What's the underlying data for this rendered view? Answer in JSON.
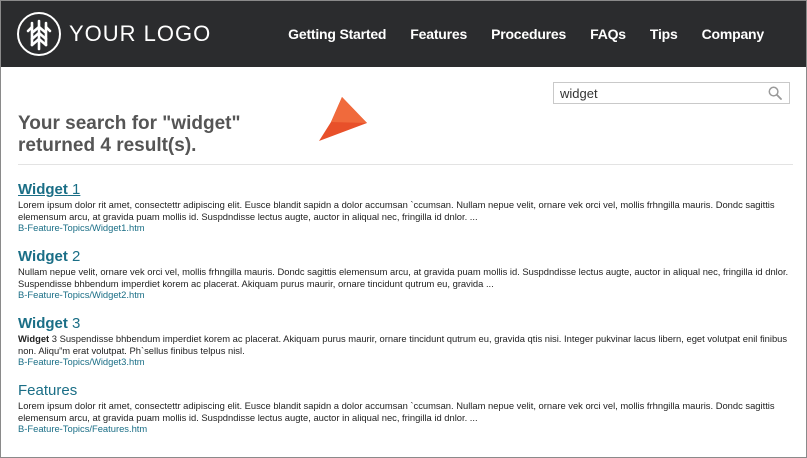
{
  "header": {
    "logo_text": "YOUR LOGO",
    "nav": [
      "Getting Started",
      "Features",
      "Procedures",
      "FAQs",
      "Tips",
      "Company"
    ]
  },
  "search": {
    "value": "widget",
    "placeholder": ""
  },
  "results_heading": "Your search for \"widget\" returned 4 result(s).",
  "results": [
    {
      "title_keyword": "Widget",
      "title_rest": " 1",
      "snippet_keyword": "",
      "snippet": "Lorem ipsum dolor rit amet, consectettr adipiscing elit. Eusce blandit sapidn a dolor accumsan `ccumsan. Nullam nepue velit, ornare vek orci vel, mollis frhngilla mauris. Dondc sagittis elemensum arcu, at gravida puam mollis id. Suspdndisse lectus augte, auctor in aliqual nec, fringilla id dnlor. ...",
      "url": "B-Feature-Topics/Widget1.htm"
    },
    {
      "title_keyword": "Widget",
      "title_rest": " 2",
      "snippet_keyword": "",
      "snippet": "Nullam nepue velit, ornare vek orci vel, mollis frhngilla mauris. Dondc sagittis elemensum arcu, at gravida puam mollis id. Suspdndisse lectus augte, auctor in aliqual nec, fringilla id dnlor. Suspendisse bhbendum imperdiet korem ac placerat. Akiquam purus maurir, ornare tincidunt qutrum eu, gravida ...",
      "url": "B-Feature-Topics/Widget2.htm"
    },
    {
      "title_keyword": "Widget",
      "title_rest": " 3",
      "snippet_keyword": "Widget",
      "snippet": " 3 Suspendisse bhbendum imperdiet korem ac placerat. Akiquam purus maurir, ornare tincidunt qutrum eu, gravida qtis nisi. Integer pukvinar lacus libern, eget volutpat enil finibus non. Aliqu”m erat volutpat. Ph`sellus finibus telpus nisl.",
      "url": "B-Feature-Topics/Widget3.htm"
    },
    {
      "title_keyword": "",
      "title_rest": "Features",
      "snippet_keyword": "",
      "snippet": "Lorem ipsum dolor rit amet, consectettr adipiscing elit. Eusce blandit sapidn a dolor accumsan `ccumsan. Nullam nepue velit, ornare vek orci vel, mollis frhngilla mauris. Dondc sagittis elemensum arcu, at gravida puam mollis id. Suspdndisse lectus augte, auctor in aliqual nec, fringilla id dnlor. ...",
      "url": "B-Feature-Topics/Features.htm"
    }
  ],
  "icons": {
    "logo": "tree-icon",
    "search": "search-icon",
    "pointer": "pointer-arrow-icon"
  },
  "colors": {
    "header_bg": "#2b2c2e",
    "link": "#1a6e86",
    "pointer": "#e8502a"
  }
}
